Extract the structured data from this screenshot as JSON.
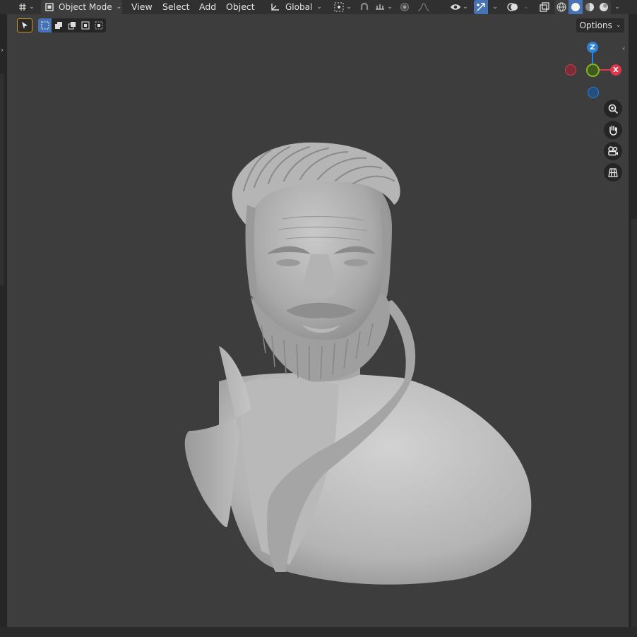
{
  "header": {
    "mode": "Object Mode",
    "menus": [
      "View",
      "Select",
      "Add",
      "Object"
    ],
    "transform_orientation": "Global",
    "options_label": "Options"
  },
  "gizmo": {
    "z_label": "Z",
    "x_label": "X",
    "colors": {
      "x": "#e0364b",
      "y": "#85b528",
      "z": "#2c82d6"
    }
  },
  "icons": {
    "editor_type": "grid-move-icon",
    "mode": "object-mode-icon",
    "orientation": "global-orientation-icon",
    "pivot": "pivot-point-icon",
    "snap": "snap-magnet-icon",
    "snap_target": "snap-increment-icon",
    "proportional": "proportional-edit-icon",
    "falloff": "falloff-curve-icon",
    "visibility": "eye-visibility-icon",
    "gizmos": "gizmo-toggle-icon",
    "overlays": "overlays-icon",
    "xray": "xray-icon",
    "wireframe": "wireframe-shading-icon",
    "solid": "solid-shading-icon",
    "material": "material-preview-icon",
    "rendered": "rendered-shading-icon",
    "zoom": "zoom-icon",
    "pan": "pan-hand-icon",
    "camera": "camera-view-icon",
    "perspective": "perspective-grid-icon"
  }
}
